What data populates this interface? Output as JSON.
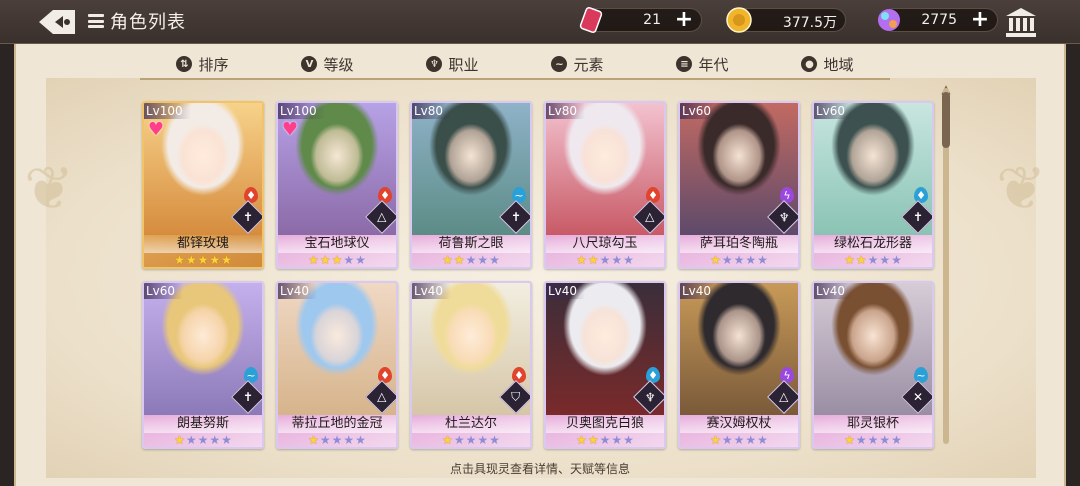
{
  "header": {
    "title": "角色列表",
    "resources": [
      {
        "icon": "ticket-icon",
        "value": "21",
        "color": "#d93a5c"
      },
      {
        "icon": "gold-coin-icon",
        "value": "377.5万",
        "color": "#f0b52c"
      },
      {
        "icon": "gem-icon",
        "value": "2775",
        "color": "#b46ef0"
      }
    ]
  },
  "tabs": [
    {
      "label": "排序",
      "icon": "sort-icon",
      "glyph": "⇅"
    },
    {
      "label": "等级",
      "icon": "level-icon",
      "glyph": "V"
    },
    {
      "label": "职业",
      "icon": "class-icon",
      "glyph": "♆"
    },
    {
      "label": "元素",
      "icon": "element-icon",
      "glyph": "~"
    },
    {
      "label": "年代",
      "icon": "era-icon",
      "glyph": "≡"
    },
    {
      "label": "地域",
      "icon": "region-icon",
      "glyph": "●"
    }
  ],
  "cards": [
    {
      "level": "Lv100",
      "name": "都铎玫瑰",
      "stars": 5,
      "heart": true,
      "gold": true,
      "element_color": "#e0442c",
      "element_glyph": "♦",
      "job_glyph": "✝",
      "hair": "#f3ece6",
      "bg1": "#f7d28a",
      "bg2": "#d68c3e"
    },
    {
      "level": "Lv100",
      "name": "宝石地球仪",
      "stars": 3,
      "heart": true,
      "gold": false,
      "element_color": "#e0442c",
      "element_glyph": "♦",
      "job_glyph": "△",
      "hair": "#5f8a4a",
      "bg1": "#b6a2e6",
      "bg2": "#8c6aa8"
    },
    {
      "level": "Lv80",
      "name": "荷鲁斯之眼",
      "stars": 2,
      "heart": false,
      "gold": false,
      "element_color": "#2aa0d8",
      "element_glyph": "~",
      "job_glyph": "✝",
      "hair": "#3a4e4a",
      "bg1": "#8fb2c8",
      "bg2": "#5c8c86"
    },
    {
      "level": "Lv80",
      "name": "八尺琼勾玉",
      "stars": 2,
      "heart": false,
      "gold": false,
      "element_color": "#e0442c",
      "element_glyph": "♦",
      "job_glyph": "△",
      "hair": "#efe9ef",
      "bg1": "#f3c2cf",
      "bg2": "#c85a66"
    },
    {
      "level": "Lv60",
      "name": "萨耳珀冬陶瓶",
      "stars": 1,
      "heart": false,
      "gold": false,
      "element_color": "#9a48e0",
      "element_glyph": "ϟ",
      "job_glyph": "♆",
      "hair": "#3a2a2a",
      "bg1": "#c26a62",
      "bg2": "#5e4a6a"
    },
    {
      "level": "Lv60",
      "name": "绿松石龙形器",
      "stars": 2,
      "heart": false,
      "gold": false,
      "element_color": "#2aa0d8",
      "element_glyph": "♦",
      "job_glyph": "✝",
      "hair": "#3d5250",
      "bg1": "#c8e6e0",
      "bg2": "#8ac3b4"
    },
    {
      "level": "Lv60",
      "name": "朗基努斯",
      "stars": 1,
      "heart": false,
      "gold": false,
      "element_color": "#2aa0d8",
      "element_glyph": "~",
      "job_glyph": "✝",
      "hair": "#e8c77a",
      "bg1": "#c4b0ec",
      "bg2": "#8c7ab8"
    },
    {
      "level": "Lv40",
      "name": "蒂拉丘地的金冠",
      "stars": 1,
      "heart": false,
      "gold": false,
      "element_color": "#e0442c",
      "element_glyph": "♦",
      "job_glyph": "△",
      "hair": "#9fc8ef",
      "bg1": "#f0d8c4",
      "bg2": "#d6b48c"
    },
    {
      "level": "Lv40",
      "name": "杜兰达尔",
      "stars": 1,
      "heart": false,
      "gold": false,
      "element_color": "#e0442c",
      "element_glyph": "♦",
      "job_glyph": "⛉",
      "hair": "#f0dc9a",
      "bg1": "#f2eee0",
      "bg2": "#d6c6a8"
    },
    {
      "level": "Lv40",
      "name": "贝奥图克白狼",
      "stars": 2,
      "heart": false,
      "gold": false,
      "element_color": "#2aa0d8",
      "element_glyph": "♦",
      "job_glyph": "♆",
      "hair": "#ececf0",
      "bg1": "#3a2e3a",
      "bg2": "#7a2a2a"
    },
    {
      "level": "Lv40",
      "name": "赛汉姆权杖",
      "stars": 1,
      "heart": false,
      "gold": false,
      "element_color": "#9a48e0",
      "element_glyph": "ϟ",
      "job_glyph": "△",
      "hair": "#2e2a2e",
      "bg1": "#c89a58",
      "bg2": "#7a5a3a"
    },
    {
      "level": "Lv40",
      "name": "耶灵银杯",
      "stars": 1,
      "heart": false,
      "gold": false,
      "element_color": "#2aa0d8",
      "element_glyph": "~",
      "job_glyph": "✕",
      "hair": "#7a5032",
      "bg1": "#d6ccd6",
      "bg2": "#9a8ea4"
    }
  ],
  "hint": "点击具现灵查看详情、天赋等信息"
}
